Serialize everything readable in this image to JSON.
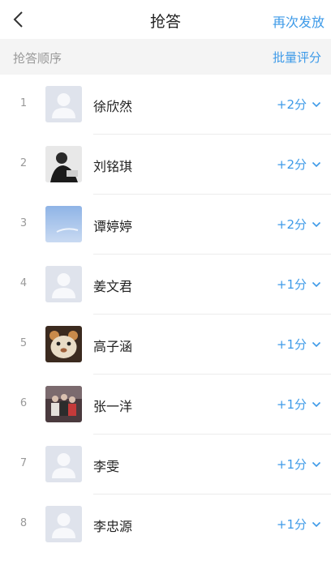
{
  "header": {
    "title": "抢答",
    "action_label": "再次发放"
  },
  "section": {
    "label": "抢答顺序",
    "batch_label": "批量评分"
  },
  "icons": {
    "back": "back-chevron-icon",
    "expand": "chevron-down-icon"
  },
  "colors": {
    "accent": "#3d9ae8",
    "placeholder_avatar": "#dfe3ec"
  },
  "rows": [
    {
      "rank": "1",
      "name": "徐欣然",
      "score": "+2分",
      "avatar": "placeholder"
    },
    {
      "rank": "2",
      "name": "刘铭琪",
      "score": "+2分",
      "avatar": "photo-dark"
    },
    {
      "rank": "3",
      "name": "谭婷婷",
      "score": "+2分",
      "avatar": "photo-sky"
    },
    {
      "rank": "4",
      "name": "姜文君",
      "score": "+1分",
      "avatar": "placeholder"
    },
    {
      "rank": "5",
      "name": "高子涵",
      "score": "+1分",
      "avatar": "photo-plush"
    },
    {
      "rank": "6",
      "name": "张一洋",
      "score": "+1分",
      "avatar": "photo-group"
    },
    {
      "rank": "7",
      "name": "李雯",
      "score": "+1分",
      "avatar": "placeholder"
    },
    {
      "rank": "8",
      "name": "李忠源",
      "score": "+1分",
      "avatar": "placeholder"
    }
  ]
}
